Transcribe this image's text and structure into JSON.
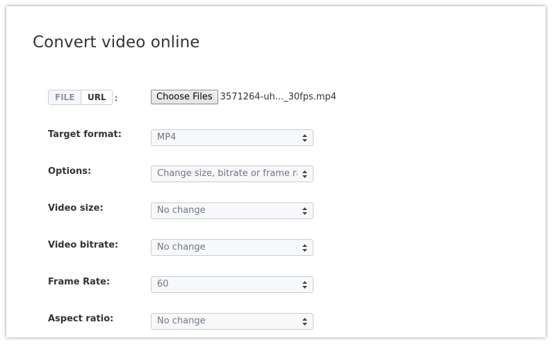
{
  "page": {
    "title": "Convert video online"
  },
  "source_toggle": {
    "file_label": "FILE",
    "url_label": "URL",
    "colon": ":",
    "selected": "URL"
  },
  "file_input": {
    "button_label": "Choose Files",
    "file_name": "3571264-uh..._30fps.mp4"
  },
  "fields": {
    "target_format": {
      "label": "Target format:",
      "value": "MP4"
    },
    "options": {
      "label": "Options:",
      "value": "Change size, bitrate or frame rate"
    },
    "video_size": {
      "label": "Video size:",
      "value": "No change"
    },
    "video_bitrate": {
      "label": "Video bitrate:",
      "value": "No change"
    },
    "frame_rate": {
      "label": "Frame Rate:",
      "value": "60"
    },
    "aspect_ratio": {
      "label": "Aspect ratio:",
      "value": "No change"
    }
  },
  "icons": {
    "select_arrow": "up-down-caret-icon"
  },
  "colors": {
    "text": "#333333",
    "muted_text": "#6f7680",
    "select_bg": "#f7f8fa",
    "border": "#c8ccd1"
  }
}
